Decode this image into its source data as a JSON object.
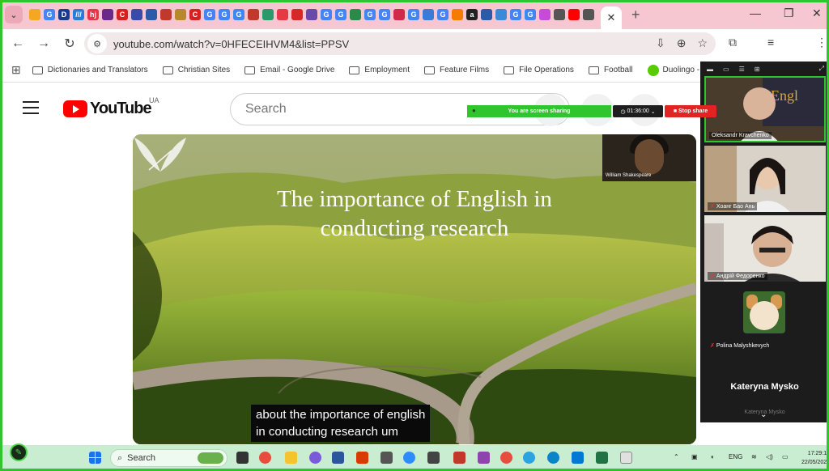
{
  "browser": {
    "url": "youtube.com/watch?v=0HFECEIHVM4&list=PPSV",
    "tab_favicons": [
      {
        "letter": "",
        "color": "#f5a623"
      },
      {
        "letter": "G",
        "color": "#4285f4"
      },
      {
        "letter": "D",
        "color": "#1a3a8a"
      },
      {
        "letter": "///",
        "color": "#2a7ad8"
      },
      {
        "letter": "hj",
        "color": "#e8334a"
      },
      {
        "letter": "",
        "color": "#6a2a8a"
      },
      {
        "letter": "C",
        "color": "#d92020"
      },
      {
        "letter": "",
        "color": "#3a4aa8"
      },
      {
        "letter": "",
        "color": "#2a5aa8"
      },
      {
        "letter": "",
        "color": "#c0392b"
      },
      {
        "letter": "",
        "color": "#b7892a"
      },
      {
        "letter": "C",
        "color": "#d92020"
      },
      {
        "letter": "G",
        "color": "#4285f4"
      },
      {
        "letter": "G",
        "color": "#4285f4"
      },
      {
        "letter": "G",
        "color": "#4285f4"
      },
      {
        "letter": "",
        "color": "#c0392b"
      },
      {
        "letter": "",
        "color": "#2a9a6a"
      },
      {
        "letter": "",
        "color": "#e63946"
      },
      {
        "letter": "",
        "color": "#d62828"
      },
      {
        "letter": "",
        "color": "#6a4aa8"
      },
      {
        "letter": "G",
        "color": "#4285f4"
      },
      {
        "letter": "G",
        "color": "#4285f4"
      },
      {
        "letter": "",
        "color": "#2a8a4a"
      },
      {
        "letter": "G",
        "color": "#4285f4"
      },
      {
        "letter": "G",
        "color": "#4285f4"
      },
      {
        "letter": "",
        "color": "#d02a4a"
      },
      {
        "letter": "G",
        "color": "#4285f4"
      },
      {
        "letter": "",
        "color": "#3a7ad8"
      },
      {
        "letter": "G",
        "color": "#4285f4"
      },
      {
        "letter": "",
        "color": "#f57c00"
      },
      {
        "letter": "a",
        "color": "#222222"
      },
      {
        "letter": "",
        "color": "#2a5aa8"
      },
      {
        "letter": "",
        "color": "#3a8ad8"
      },
      {
        "letter": "G",
        "color": "#4285f4"
      },
      {
        "letter": "G",
        "color": "#4285f4"
      },
      {
        "letter": "",
        "color": "#c84ad8"
      },
      {
        "letter": "",
        "color": "#555555"
      },
      {
        "letter": "",
        "color": "#ff0000"
      },
      {
        "letter": "",
        "color": "#555555"
      }
    ],
    "bookmarks": [
      {
        "label": "Dictionaries and Translators",
        "icon": "folder-icon"
      },
      {
        "label": "Christian Sites",
        "icon": "folder-icon"
      },
      {
        "label": "Email - Google Drive",
        "icon": "folder-icon"
      },
      {
        "label": "Employment",
        "icon": "folder-icon"
      },
      {
        "label": "Feature Films",
        "icon": "folder-icon"
      },
      {
        "label": "File Operations",
        "icon": "folder-icon"
      },
      {
        "label": "Football",
        "icon": "folder-icon"
      },
      {
        "label": "Duolingo - The world's bes...",
        "icon": "duolingo-icon"
      }
    ]
  },
  "youtube": {
    "logo_text": "YouTube",
    "region": "UA",
    "search_placeholder": "Search"
  },
  "sharing": {
    "status": "You are screen sharing",
    "timer": "01:36:00",
    "stop_label": "Stop share"
  },
  "video": {
    "title_line1": "The importance of English in",
    "title_line2": "conducting research",
    "pip_name": "William Shakespeare",
    "caption_line1": "about the importance of english",
    "caption_line2": "in conducting research um"
  },
  "meeting": {
    "participants": [
      {
        "name": "Oleksandr Kravchenko",
        "muted": false
      },
      {
        "name": "Хоанг Бао Ань",
        "muted": true
      },
      {
        "name": "Андрій Федоренко",
        "muted": true
      },
      {
        "name": "Polina Malyshkevych",
        "muted": true
      }
    ],
    "name_only": "Kateryna Mysko",
    "cut_label": "Kateryna Mysko"
  },
  "taskbar": {
    "search_label": "Search",
    "lang": "ENG",
    "time": "17:29:15",
    "date": "22/05/2025"
  },
  "colors": {
    "share_green": "#2fc52f",
    "stop_red": "#e02424",
    "tabstrip": "#f7c7d1",
    "taskbar": "#c8edd0",
    "youtube_red": "#ff0000"
  }
}
